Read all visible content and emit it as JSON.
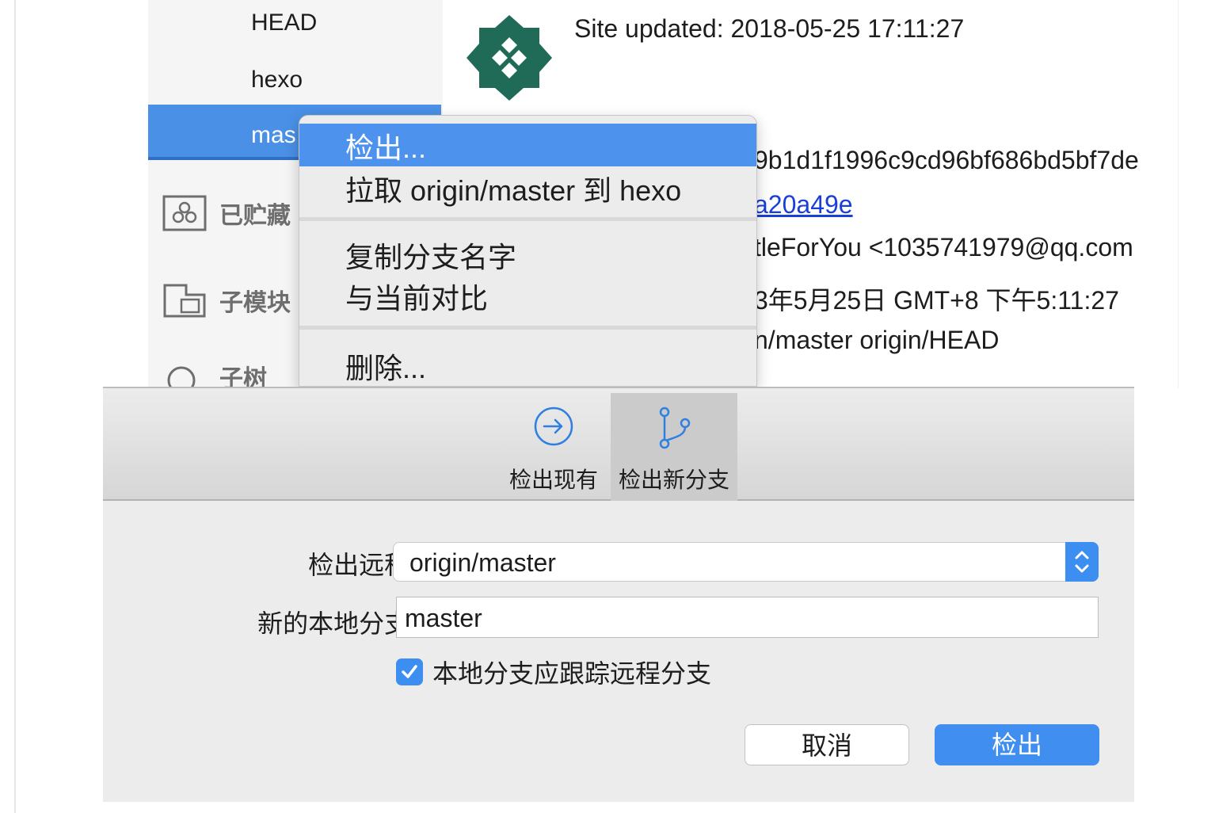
{
  "sidebar": {
    "branches": [
      "HEAD",
      "hexo"
    ],
    "selected_branch_truncated": "mas",
    "sections": {
      "stashes": "已贮藏",
      "submodules": "子模块",
      "subtrees_partial": "子树"
    }
  },
  "commit": {
    "title": "Site updated: 2018-05-25 17:11:27",
    "sha_partial": "9b1d1f1996c9cd96bf686bd5bf7de",
    "parent_partial": "a20a49e",
    "author_partial": "tleForYou <1035741979@qq.com",
    "date_partial": "3年5月25日 GMT+8 下午5:11:27",
    "refs_partial": "n/master origin/HEAD"
  },
  "context_menu": {
    "items": {
      "checkout": "检出...",
      "pull": "拉取 origin/master 到 hexo",
      "copy_name": "复制分支名字",
      "diff_current": "与当前对比",
      "delete": "删除..."
    }
  },
  "dialog": {
    "tabs": {
      "existing": "检出现有",
      "new_branch": "检出新分支"
    },
    "remote_label": "检出远程分支:",
    "remote_value": "origin/master",
    "local_label": "新的本地分支名称:",
    "local_value": "master",
    "track_label": "本地分支应跟踪远程分支",
    "track_checked": true,
    "cancel": "取消",
    "confirm": "检出"
  },
  "colors": {
    "accent": "#4a90e6",
    "logo": "#1f6b57",
    "link": "#1a3fd8"
  }
}
